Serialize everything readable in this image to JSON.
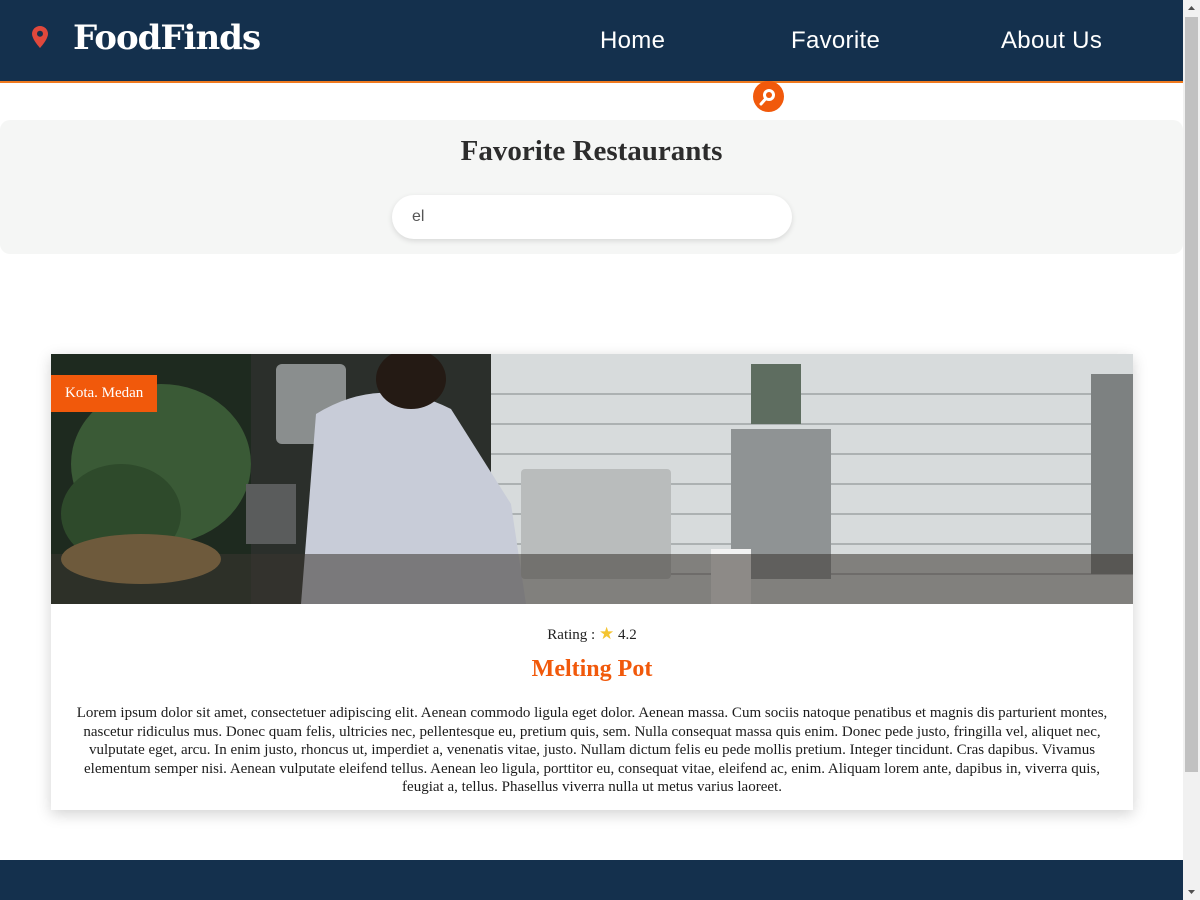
{
  "header": {
    "brand": "FoodFinds",
    "brand_icon": "map-pin-icon",
    "nav": [
      {
        "label": "Home"
      },
      {
        "label": "Favorite"
      },
      {
        "label": "About Us"
      }
    ],
    "colors": {
      "background": "#14304d",
      "accent_border": "#f07a1e"
    }
  },
  "hero": {
    "title": "Favorite Restaurants",
    "search": {
      "value": "el",
      "button_icon": "search-icon"
    }
  },
  "restaurants": [
    {
      "city": "Kota. Medan",
      "rating_label": "Rating :",
      "rating_icon": "star-icon",
      "rating": "4.2",
      "name": "Melting Pot",
      "description": "Lorem ipsum dolor sit amet, consectetuer adipiscing elit. Aenean commodo ligula eget dolor. Aenean massa. Cum sociis natoque penatibus et magnis dis parturient montes, nascetur ridiculus mus. Donec quam felis, ultricies nec, pellentesque eu, pretium quis, sem. Nulla consequat massa quis enim. Donec pede justo, fringilla vel, aliquet nec, vulputate eget, arcu. In enim justo, rhoncus ut, imperdiet a, venenatis vitae, justo. Nullam dictum felis eu pede mollis pretium. Integer tincidunt. Cras dapibus. Vivamus elementum semper nisi. Aenean vulputate eleifend tellus. Aenean leo ligula, porttitor eu, consequat vitae, eleifend ac, enim. Aliquam lorem ante, dapibus in, viverra quis, feugiat a, tellus. Phasellus viverra nulla ut metus varius laoreet."
    }
  ],
  "theme": {
    "accent": "#f1590b",
    "dark": "#14304d"
  }
}
